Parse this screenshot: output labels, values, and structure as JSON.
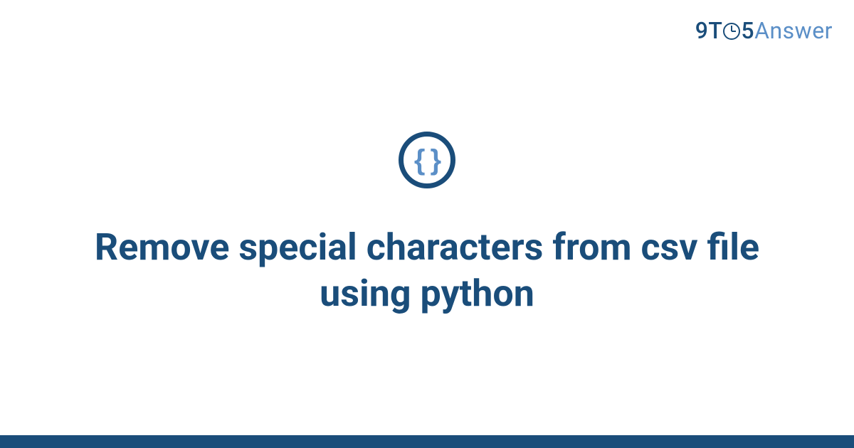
{
  "brand": {
    "part1": "9",
    "part2": "T",
    "part3": "5",
    "part4": "Answer"
  },
  "icon": {
    "symbol": "{ }"
  },
  "title": "Remove special characters from csv file using python",
  "colors": {
    "primary": "#1a4d7a",
    "accent": "#5b8fc7"
  }
}
